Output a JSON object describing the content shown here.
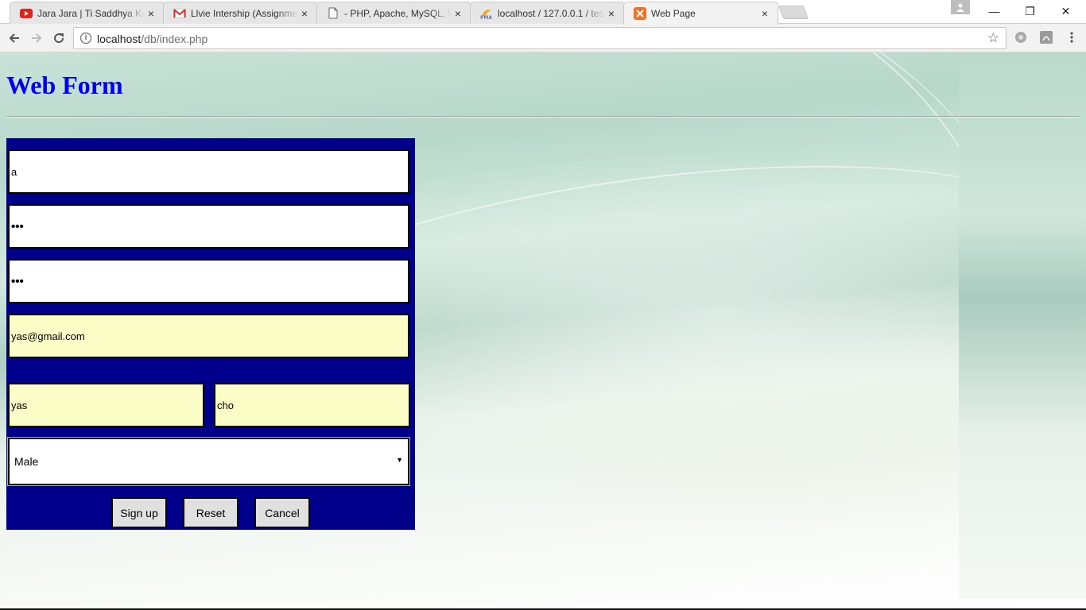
{
  "browser": {
    "tabs": [
      {
        "title": "Jara Jara | Ti Saddhya Kay",
        "icon": "youtube-icon",
        "close": "×"
      },
      {
        "title": "Llvie Intership (Assignme",
        "icon": "gmail-icon",
        "close": "×"
      },
      {
        "title": "- PHP, Apache, MySQL, W",
        "icon": "page-icon",
        "close": "×"
      },
      {
        "title": "localhost / 127.0.0.1 / tes",
        "icon": "phpmyadmin-icon",
        "close": "×"
      },
      {
        "title": "Web Page",
        "icon": "xampp-icon",
        "close": "×"
      }
    ],
    "active_tab": 4,
    "url_host": "localhost",
    "url_path": "/db/index.php",
    "window_controls": {
      "minimize": "—",
      "restore": "❐",
      "close": "✕"
    }
  },
  "page": {
    "title": "Web Form",
    "form": {
      "field1_value": "a",
      "field2_value": "•••",
      "field3_value": "•••",
      "email_value": "yas@gmail.com",
      "first_name_value": "yas",
      "last_name_value": "cho",
      "gender_selected": "Male",
      "buttons": {
        "signup": "Sign up",
        "reset": "Reset",
        "cancel": "Cancel"
      }
    }
  },
  "colors": {
    "form_background": "#00008b",
    "title_color": "#0000ee",
    "autofill_background": "#fafdc6"
  }
}
